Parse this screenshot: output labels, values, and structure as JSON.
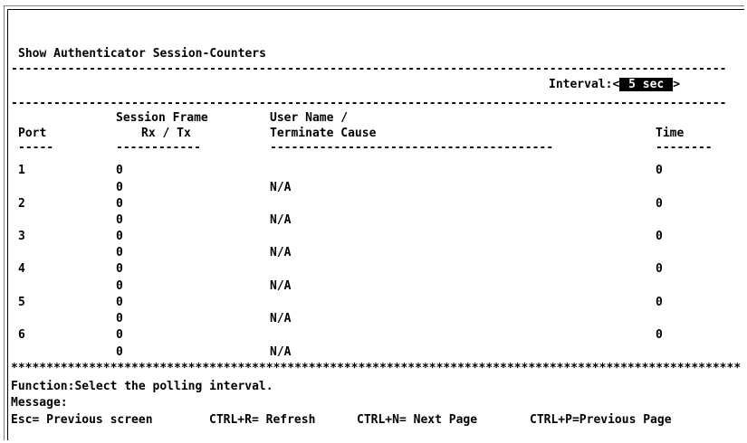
{
  "title": "Show Authenticator Session-Counters",
  "separator_dash": "-----------------------------------------------------------------------------------------------------",
  "interval": {
    "label": "Interval:<",
    "value": " 5 sec ",
    "suffix": ">"
  },
  "table": {
    "headers": {
      "port": "Port",
      "session_frame": "Session Frame",
      "rx_tx": "Rx / Tx",
      "user_name": "User Name /",
      "terminate_cause": "Terminate Cause",
      "time": "Time"
    },
    "underlines": {
      "port": "-----",
      "session": "------------",
      "user": "----------------------------------------",
      "time": "--------"
    },
    "rows": [
      {
        "port": "1",
        "rx": "0",
        "tx": "0",
        "user": "N/A",
        "time": "0"
      },
      {
        "port": "2",
        "rx": "0",
        "tx": "0",
        "user": "N/A",
        "time": "0"
      },
      {
        "port": "3",
        "rx": "0",
        "tx": "0",
        "user": "N/A",
        "time": "0"
      },
      {
        "port": "4",
        "rx": "0",
        "tx": "0",
        "user": "N/A",
        "time": "0"
      },
      {
        "port": "5",
        "rx": "0",
        "tx": "0",
        "user": "N/A",
        "time": "0"
      },
      {
        "port": "6",
        "rx": "0",
        "tx": "0",
        "user": "N/A",
        "time": "0"
      }
    ]
  },
  "stars": "*******************************************************************************************************",
  "function_line": "Function:Select the polling interval.",
  "message_line": "Message:",
  "keys": {
    "esc": "Esc= Previous screen",
    "refresh": "CTRL+R= Refresh",
    "next": "CTRL+N= Next Page",
    "prev": "CTRL+P=Previous Page"
  }
}
